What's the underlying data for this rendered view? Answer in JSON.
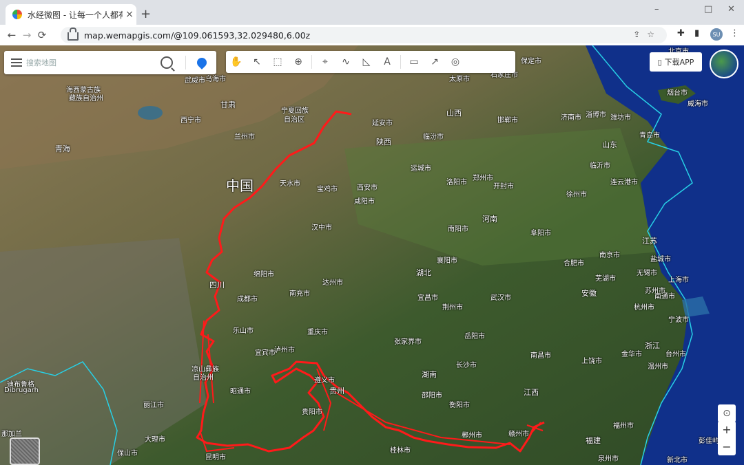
{
  "browser": {
    "tab_title": "水经微图 - 让每一个人都有自己",
    "new_tab": "+",
    "tab_close": "×",
    "win_min": "–",
    "win_max": "□",
    "win_close": "✕",
    "url": "map.wemapgis.com/@109.061593,32.029480,6.00z",
    "avatar_text": "SU"
  },
  "search": {
    "placeholder": "搜索地图"
  },
  "download_button": "下载APP",
  "zoom": {
    "in": "+",
    "out": "−"
  },
  "map_labels": [
    {
      "text": "北京市"
    },
    {
      "text": "保定市"
    },
    {
      "text": "石家庄市"
    },
    {
      "text": "太原市"
    },
    {
      "text": "乌海市"
    },
    {
      "text": "武威市"
    },
    {
      "text": "海西蒙古族"
    },
    {
      "text": "藏族自治州"
    },
    {
      "text": "西宁市"
    },
    {
      "text": "青海"
    },
    {
      "text": "甘肃"
    },
    {
      "text": "宁夏回族"
    },
    {
      "text": "自治区"
    },
    {
      "text": "兰州市"
    },
    {
      "text": "延安市"
    },
    {
      "text": "陕西"
    },
    {
      "text": "山西"
    },
    {
      "text": "临汾市"
    },
    {
      "text": "邯郸市"
    },
    {
      "text": "济南市"
    },
    {
      "text": "淄博市"
    },
    {
      "text": "潍坊市"
    },
    {
      "text": "烟台市"
    },
    {
      "text": "威海市"
    },
    {
      "text": "青岛市"
    },
    {
      "text": "山东"
    },
    {
      "text": "临沂市"
    },
    {
      "text": "连云港市"
    },
    {
      "text": "运城市"
    },
    {
      "text": "郑州市"
    },
    {
      "text": "开封市"
    },
    {
      "text": "洛阳市"
    },
    {
      "text": "天水市"
    },
    {
      "text": "宝鸡市"
    },
    {
      "text": "西安市"
    },
    {
      "text": "咸阳市"
    },
    {
      "text": "徐州市"
    },
    {
      "text": "中国"
    },
    {
      "text": "汉中市"
    },
    {
      "text": "南阳市"
    },
    {
      "text": "河南"
    },
    {
      "text": "阜阳市"
    },
    {
      "text": "江苏"
    },
    {
      "text": "盐城市"
    },
    {
      "text": "南通市"
    },
    {
      "text": "南京市"
    },
    {
      "text": "合肥市"
    },
    {
      "text": "襄阳市"
    },
    {
      "text": "湖北"
    },
    {
      "text": "无锡市"
    },
    {
      "text": "芜湖市"
    },
    {
      "text": "苏州市"
    },
    {
      "text": "上海市"
    },
    {
      "text": "绵阳市"
    },
    {
      "text": "四川"
    },
    {
      "text": "达州市"
    },
    {
      "text": "南充市"
    },
    {
      "text": "宜昌市"
    },
    {
      "text": "成都市"
    },
    {
      "text": "荆州市"
    },
    {
      "text": "武汉市"
    },
    {
      "text": "安徽"
    },
    {
      "text": "杭州市"
    },
    {
      "text": "宁波市"
    },
    {
      "text": "乐山市"
    },
    {
      "text": "重庆市"
    },
    {
      "text": "岳阳市"
    },
    {
      "text": "张家界市"
    },
    {
      "text": "宜宾市"
    },
    {
      "text": "泸州市"
    },
    {
      "text": "浙江"
    },
    {
      "text": "金华市"
    },
    {
      "text": "台州市"
    },
    {
      "text": "南昌市"
    },
    {
      "text": "上饶市"
    },
    {
      "text": "长沙市"
    },
    {
      "text": "遵义市"
    },
    {
      "text": "湖南"
    },
    {
      "text": "凉山彝族"
    },
    {
      "text": "自治州"
    },
    {
      "text": "贵州"
    },
    {
      "text": "江西"
    },
    {
      "text": "温州市"
    },
    {
      "text": "邵阳市"
    },
    {
      "text": "衡阳市"
    },
    {
      "text": "昭通市"
    },
    {
      "text": "迪布鲁格"
    },
    {
      "text": "Dibrugarh"
    },
    {
      "text": "丽江市"
    },
    {
      "text": "贵阳市"
    },
    {
      "text": "福州市"
    },
    {
      "text": "福建"
    },
    {
      "text": "那加兰"
    },
    {
      "text": "大理市"
    },
    {
      "text": "郴州市"
    },
    {
      "text": "赣州市"
    },
    {
      "text": "彭佳屿"
    },
    {
      "text": "保山市"
    },
    {
      "text": "昆明市"
    },
    {
      "text": "桂林市"
    },
    {
      "text": "泉州市"
    },
    {
      "text": "新北市"
    },
    {
      "text": "马"
    }
  ],
  "route": {
    "color": "#ff1a1a"
  }
}
